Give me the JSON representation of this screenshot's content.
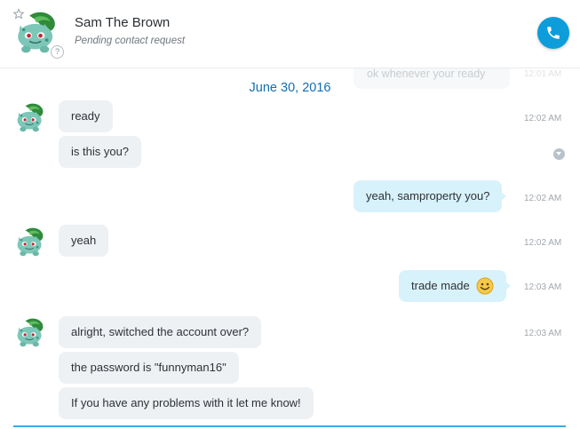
{
  "header": {
    "contact_name": "Sam The Brown",
    "contact_status": "Pending contact request"
  },
  "conversation": {
    "ghost_message": "ok whenever your ready",
    "ghost_time": "12:01 AM",
    "date_label": "June 30, 2016",
    "messages": [
      {
        "direction": "in",
        "text": "ready",
        "time": "12:02 AM"
      },
      {
        "direction": "in",
        "text": "is this you?",
        "time": ""
      },
      {
        "direction": "out",
        "text": "yeah, samproperty you?",
        "time": "12:02 AM"
      },
      {
        "direction": "in",
        "text": "yeah",
        "time": "12:02 AM"
      },
      {
        "direction": "out",
        "text": "trade made",
        "time": "12:03 AM",
        "emoji": "smiley-emoji"
      },
      {
        "direction": "in",
        "text": "alright, switched the account over?",
        "time": "12:03 AM"
      },
      {
        "direction": "in",
        "text": "the password is \"funnyman16\"",
        "time": ""
      },
      {
        "direction": "in",
        "text": "If you have any problems with it let me know!",
        "time": ""
      }
    ]
  },
  "icons": {
    "call": "phone-icon",
    "favorite": "star-icon",
    "status": "help-icon",
    "message_menu": "chevron-down-icon",
    "emoji": "smiley-emoji-icon"
  },
  "colors": {
    "accent": "#0d9ddb",
    "date_text": "#0f6fb3",
    "incoming_bubble": "#eef1f4",
    "outgoing_bubble": "#d8f2fb",
    "composer_line": "#3da9e0"
  }
}
